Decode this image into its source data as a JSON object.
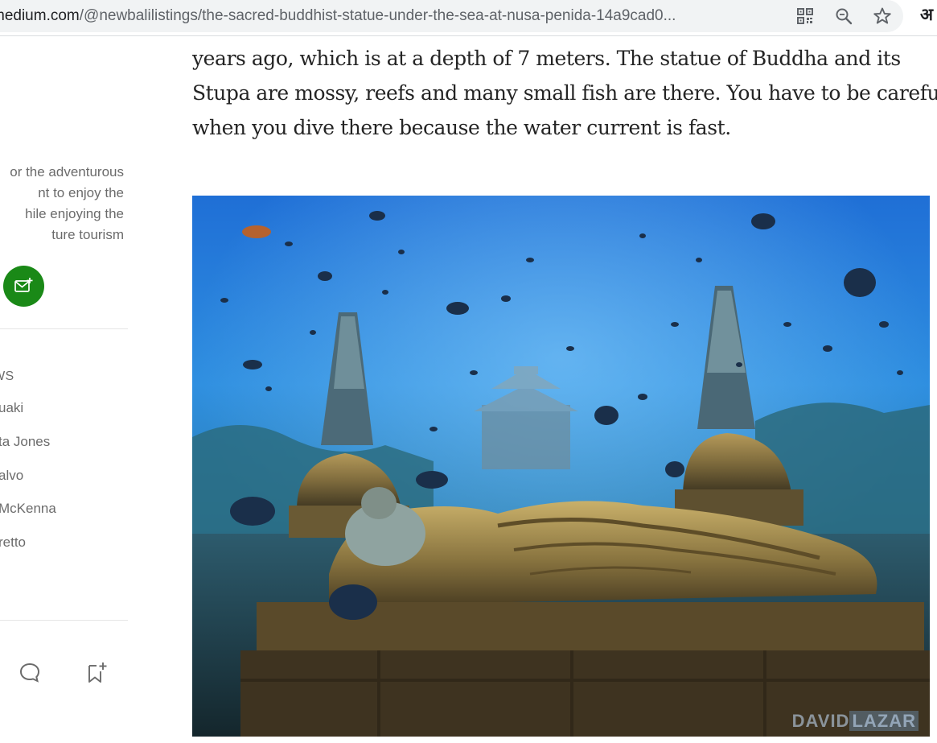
{
  "browser": {
    "url_host": "medium.com",
    "url_path": "/@newbalilistings/the-sacred-buddhist-statue-under-the-sea-at-nusa-penida-14a9cad0...",
    "icons": [
      "qr-code-icon",
      "zoom-icon",
      "star-bookmark-icon"
    ],
    "language_button": "अ"
  },
  "sidebar": {
    "bio_lines": [
      "or the adventurous",
      "nt to enjoy the",
      "hile enjoying the",
      "ture tourism"
    ],
    "subscribe_icon": "mail-plus-icon",
    "follows_heading": "LLOWS",
    "follows": [
      "uaki",
      "ta Jones",
      "alvo",
      "McKenna",
      "retto"
    ],
    "action_icons": [
      "comment-icon",
      "bookmark-add-icon"
    ]
  },
  "article": {
    "paragraph_lines": [
      "years ago, which is at a depth of 7 meters. The statue of Buddha and its",
      "Stupa are mossy, reefs and many small fish are there. You have to be careful",
      "when you dive there because the water current is fast."
    ],
    "image": {
      "subject": "reclining Buddha statue with two stupas underwater",
      "watermark_1": "DAVID",
      "watermark_2": "LAZAR"
    }
  },
  "colors": {
    "accent_green": "#1a8917",
    "text_primary": "#242424",
    "text_secondary": "#6b6b6b"
  }
}
